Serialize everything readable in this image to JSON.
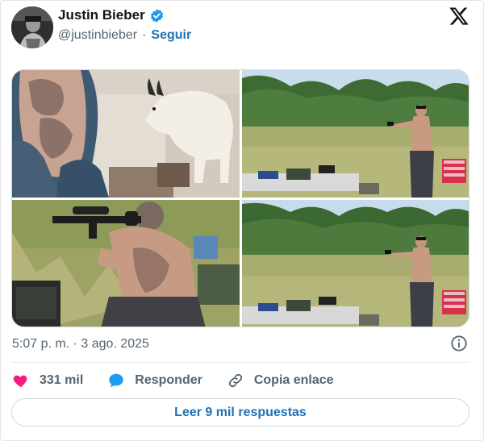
{
  "author": {
    "name": "Justin Bieber",
    "handle": "@justinbieber",
    "separator": "·",
    "follow_label": "Seguir",
    "verified": true
  },
  "brand": {
    "logo_icon": "x-logo-icon"
  },
  "media": {
    "photos": [
      {
        "subject": "tattooed-arm-and-mountain-goat"
      },
      {
        "subject": "man-shooting-handgun-in-field"
      },
      {
        "subject": "man-aiming-rifle"
      },
      {
        "subject": "man-shooting-handgun-in-field"
      }
    ]
  },
  "tweet": {
    "timestamp": "5:07 p. m. · 3 ago. 2025"
  },
  "actions": {
    "like_count": "331 mil",
    "reply_label": "Responder",
    "copy_label": "Copia enlace",
    "read_replies_label": "Leer 9 mil respuestas"
  },
  "colors": {
    "accent": "#1d72b8",
    "like": "#f91880",
    "reply": "#1d9bf0",
    "muted": "#536471",
    "verified": "#1d9bf0"
  }
}
